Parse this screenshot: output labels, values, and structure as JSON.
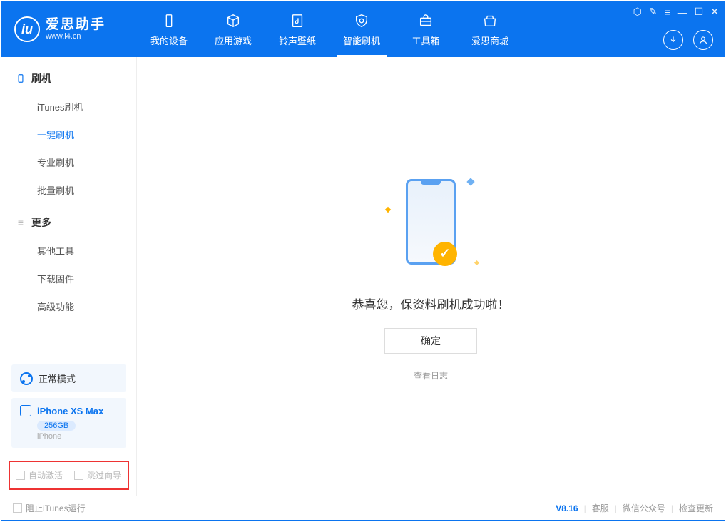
{
  "header": {
    "app_name": "爱思助手",
    "app_url": "www.i4.cn",
    "nav": [
      {
        "label": "我的设备"
      },
      {
        "label": "应用游戏"
      },
      {
        "label": "铃声壁纸"
      },
      {
        "label": "智能刷机"
      },
      {
        "label": "工具箱"
      },
      {
        "label": "爱思商城"
      }
    ]
  },
  "sidebar": {
    "section1": {
      "title": "刷机",
      "items": [
        {
          "label": "iTunes刷机"
        },
        {
          "label": "一键刷机"
        },
        {
          "label": "专业刷机"
        },
        {
          "label": "批量刷机"
        }
      ]
    },
    "section2": {
      "title": "更多",
      "items": [
        {
          "label": "其他工具"
        },
        {
          "label": "下载固件"
        },
        {
          "label": "高级功能"
        }
      ]
    },
    "mode": {
      "label": "正常模式"
    },
    "device": {
      "name": "iPhone XS Max",
      "storage": "256GB",
      "type": "iPhone"
    },
    "checks": {
      "auto_activate": "自动激活",
      "skip_guide": "跳过向导"
    }
  },
  "main": {
    "success_msg": "恭喜您，保资料刷机成功啦！",
    "ok_btn": "确定",
    "log_link": "查看日志"
  },
  "footer": {
    "block_itunes": "阻止iTunes运行",
    "version": "V8.16",
    "kefu": "客服",
    "wechat": "微信公众号",
    "update": "检查更新"
  }
}
